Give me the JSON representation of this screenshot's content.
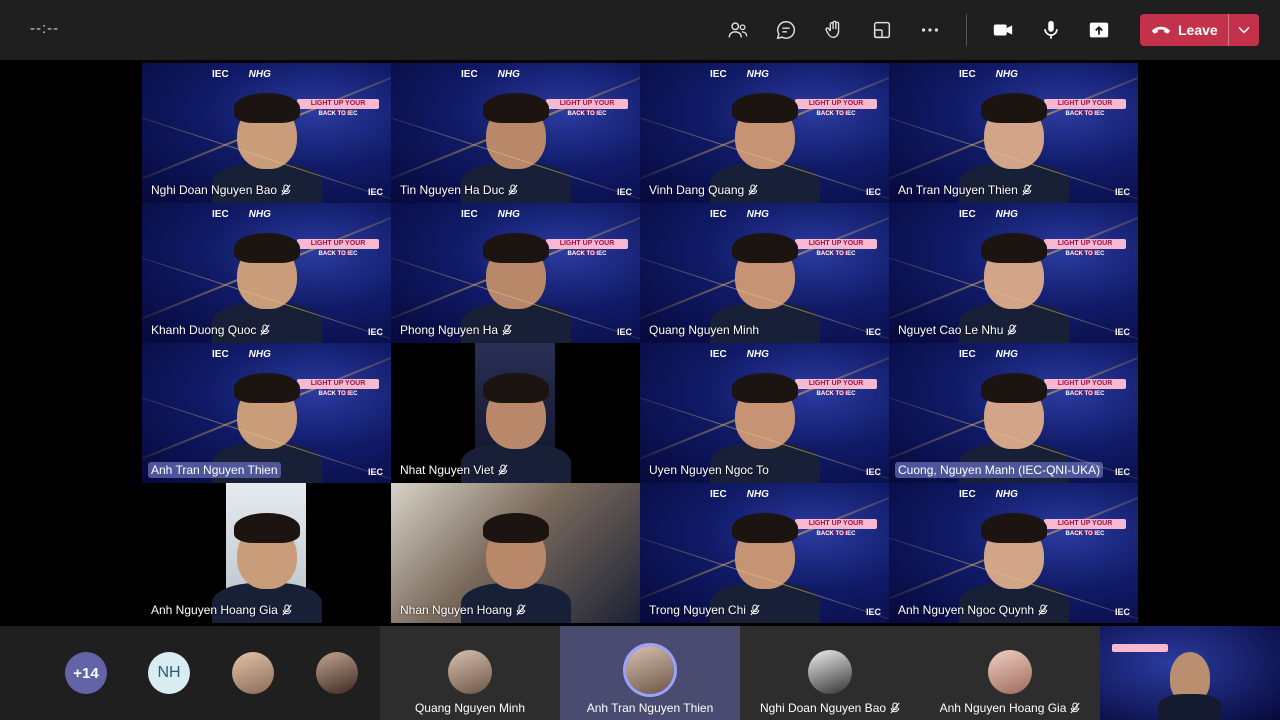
{
  "timer": "--:--",
  "leave_label": "Leave",
  "top_icons": [
    "people-icon",
    "chat-icon",
    "raise-hand-icon",
    "room-icon",
    "more-icon",
    "camera-icon",
    "mic-icon",
    "share-icon"
  ],
  "tile_logos": {
    "left": "IEC",
    "right": "NHG"
  },
  "tile_banner": {
    "line1": "LIGHT UP YOUR FUTURE",
    "line2": "BACK TO IEC"
  },
  "tile_corner": "IEC",
  "tiles": [
    {
      "name": "Nghi Doan Nguyen Bao",
      "muted": true
    },
    {
      "name": "Tin Nguyen Ha Duc",
      "muted": true
    },
    {
      "name": "Vinh Dang Quang",
      "muted": true
    },
    {
      "name": "An Tran Nguyen Thien",
      "muted": true
    },
    {
      "name": "Khanh Duong Quoc",
      "muted": true
    },
    {
      "name": "Phong Nguyen Ha",
      "muted": true
    },
    {
      "name": "Quang Nguyen Minh",
      "muted": false
    },
    {
      "name": "Nguyet Cao Le Nhu",
      "muted": true
    },
    {
      "name": "Anh Tran Nguyen Thien",
      "muted": false
    },
    {
      "name": "Nhat Nguyen Viet",
      "muted": true
    },
    {
      "name": "Uyen Nguyen Ngoc To",
      "muted": false
    },
    {
      "name": "Cuong, Nguyen Manh (IEC-QNI-UKA)",
      "muted": false
    },
    {
      "name": "Anh Nguyen Hoang Gia",
      "muted": true
    },
    {
      "name": "Nhan Nguyen Hoang",
      "muted": true
    },
    {
      "name": "Trong Nguyen Chi",
      "muted": true
    },
    {
      "name": "Anh Nguyen Ngoc Quynh",
      "muted": true
    }
  ],
  "strip": {
    "overflow_count": "+14",
    "initials": "NH",
    "slots": [
      {
        "name": "Quang Nguyen Minh",
        "muted": false
      },
      {
        "name": "Anh Tran Nguyen Thien",
        "muted": false
      },
      {
        "name": "Nghi Doan Nguyen Bao",
        "muted": true
      },
      {
        "name": "Anh Nguyen Hoang Gia",
        "muted": true
      }
    ]
  },
  "colors": {
    "accent": "#6264a7",
    "leave": "#c4314b",
    "bar": "#1f1f1f"
  }
}
